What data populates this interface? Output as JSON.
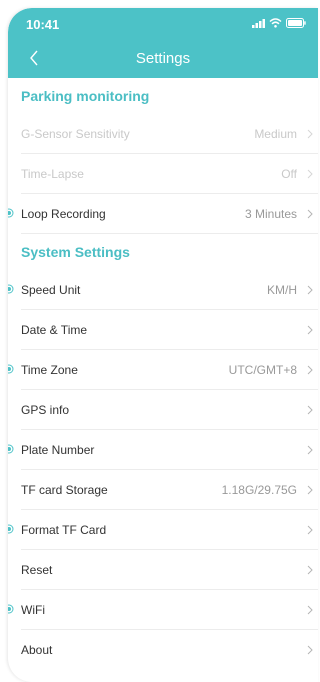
{
  "status": {
    "time": "10:41"
  },
  "header": {
    "title": "Settings"
  },
  "sections": [
    {
      "title": "Parking monitoring",
      "rows": [
        {
          "label": "G-Sensor Sensitivity",
          "value": "Medium",
          "disabled": true,
          "dot": false
        },
        {
          "label": "Time-Lapse",
          "value": "Off",
          "disabled": true,
          "dot": false
        },
        {
          "label": "Loop Recording",
          "value": "3 Minutes",
          "disabled": false,
          "dot": true
        }
      ]
    },
    {
      "title": "System Settings",
      "rows": [
        {
          "label": "Speed Unit",
          "value": "KM/H",
          "disabled": false,
          "dot": true
        },
        {
          "label": "Date & Time",
          "value": "",
          "disabled": false,
          "dot": false
        },
        {
          "label": "Time Zone",
          "value": "UTC/GMT+8",
          "disabled": false,
          "dot": true
        },
        {
          "label": "GPS info",
          "value": "",
          "disabled": false,
          "dot": false
        },
        {
          "label": "Plate Number",
          "value": "",
          "disabled": false,
          "dot": true
        },
        {
          "label": "TF card Storage",
          "value": "1.18G/29.75G",
          "disabled": false,
          "dot": false
        },
        {
          "label": "Format TF Card",
          "value": "",
          "disabled": false,
          "dot": true
        },
        {
          "label": "Reset",
          "value": "",
          "disabled": false,
          "dot": false
        },
        {
          "label": "WiFi",
          "value": "",
          "disabled": false,
          "dot": true
        },
        {
          "label": "About",
          "value": "",
          "disabled": false,
          "dot": false
        }
      ]
    }
  ],
  "colors": {
    "accent": "#4cc2c7",
    "section_title": "#4bbec4"
  }
}
